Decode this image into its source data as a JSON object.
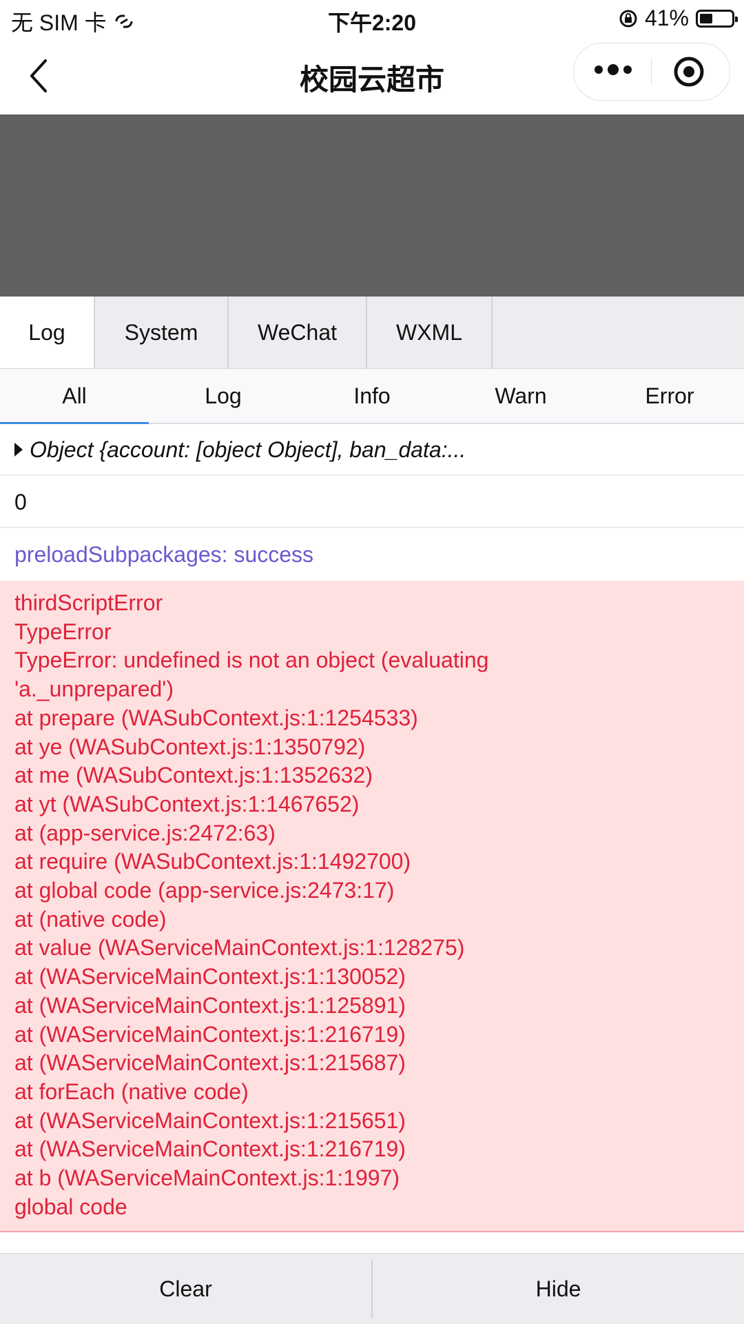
{
  "status": {
    "carrier": "无 SIM 卡",
    "time": "下午2:20",
    "battery": "41%",
    "battery_level": 0.41
  },
  "nav": {
    "title": "校园云超市"
  },
  "tabs": [
    "Log",
    "System",
    "WeChat",
    "WXML"
  ],
  "subtabs": [
    "All",
    "Log",
    "Info",
    "Warn",
    "Error"
  ],
  "logs": {
    "object_entry": "Object {account: [object Object], ban_data:...",
    "value_entry": "0",
    "info_entry": "preloadSubpackages: success",
    "error_lines": [
      "thirdScriptError",
      "TypeError",
      "TypeError: undefined is not an object (evaluating",
      "'a._unprepared')",
      "at prepare (WASubContext.js:1:1254533)",
      "at ye (WASubContext.js:1:1350792)",
      "at me (WASubContext.js:1:1352632)",
      "at yt (WASubContext.js:1:1467652)",
      "at (app-service.js:2472:63)",
      "at require (WASubContext.js:1:1492700)",
      "at global code (app-service.js:2473:17)",
      "at (native code)",
      "at value (WAServiceMainContext.js:1:128275)",
      "at (WAServiceMainContext.js:1:130052)",
      "at (WAServiceMainContext.js:1:125891)",
      "at (WAServiceMainContext.js:1:216719)",
      "at (WAServiceMainContext.js:1:215687)",
      "at forEach (native code)",
      "at (WAServiceMainContext.js:1:215651)",
      "at (WAServiceMainContext.js:1:216719)",
      "at b (WAServiceMainContext.js:1:1997)",
      "global code"
    ]
  },
  "footer": {
    "clear": "Clear",
    "hide": "Hide"
  }
}
